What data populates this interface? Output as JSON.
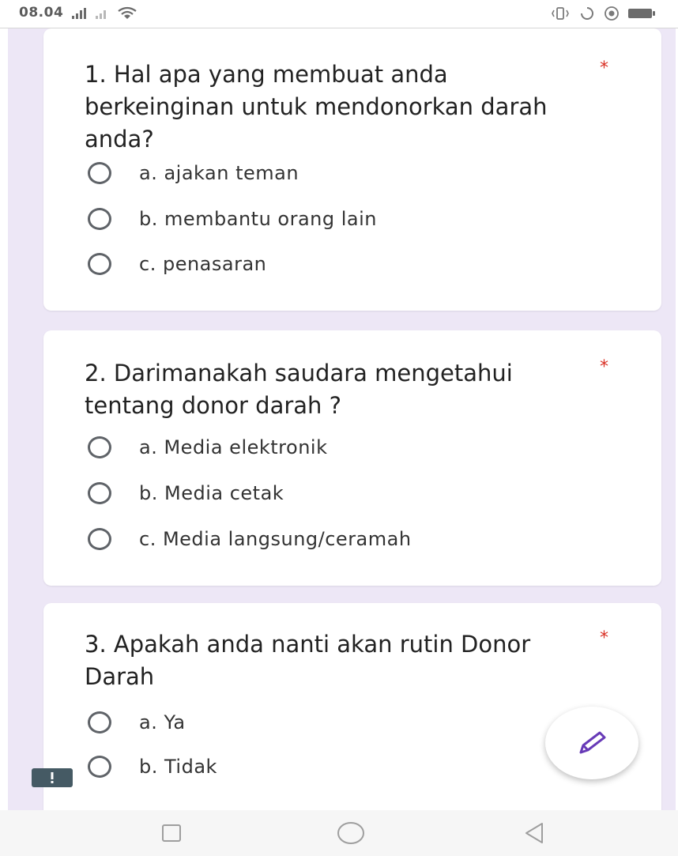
{
  "status_bar": {
    "time": "08.04"
  },
  "questions": [
    {
      "number_text": "1. Hal apa yang membuat anda berkeinginan untuk mendonorkan darah anda?",
      "required_mark": "*",
      "options": [
        "a. ajakan teman",
        "b. membantu orang lain",
        "c. penasaran"
      ]
    },
    {
      "number_text": "2. Darimanakah saudara mengetahui tentang donor darah ?",
      "required_mark": "*",
      "options": [
        "a. Media elektronik",
        "b. Media cetak",
        "c. Media langsung/ceramah"
      ]
    },
    {
      "number_text": "3. Apakah anda nanti akan rutin Donor Darah",
      "required_mark": "*",
      "options": [
        "a. Ya",
        "b. Tidak"
      ]
    }
  ],
  "colors": {
    "background": "#ede7f6",
    "required": "#d93025",
    "accent": "#673ab7"
  },
  "icons": {
    "fab": "pencil-icon",
    "feedback": "feedback-icon",
    "nav": [
      "square-icon",
      "circle-icon",
      "back-triangle-icon"
    ]
  }
}
